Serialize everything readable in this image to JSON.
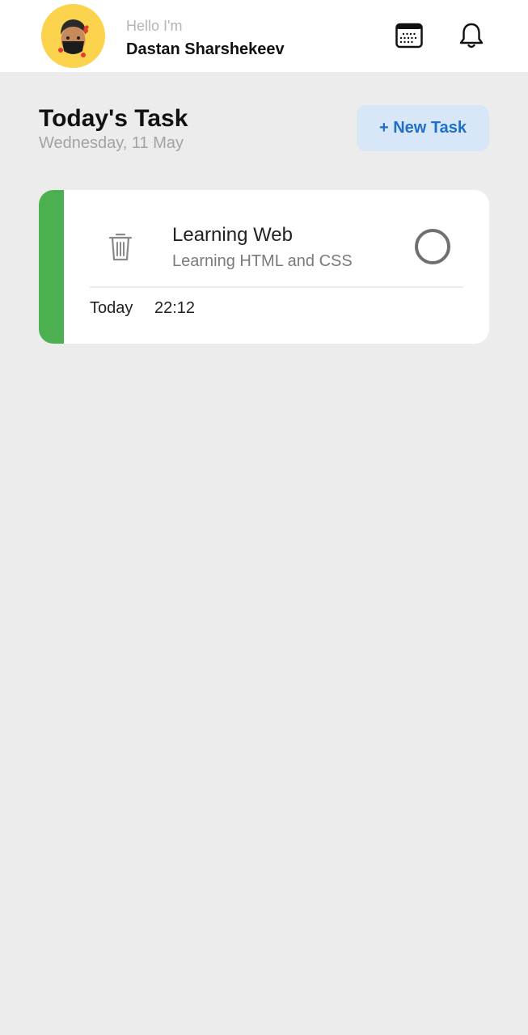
{
  "header": {
    "greeting": "Hello I'm",
    "username": "Dastan Sharshekeev",
    "avatar_bg": "#fcd34d",
    "icons": [
      "calendar-icon",
      "bell-icon"
    ]
  },
  "main": {
    "title": "Today's Task",
    "date": "Wednesday, 11 May",
    "new_task_label": "+ New Task",
    "accent_color": "#1e6fc7"
  },
  "tasks": [
    {
      "title": "Learning Web",
      "subtitle": "Learning HTML and CSS",
      "day": "Today",
      "time": "22:12",
      "status_color": "#4caf50",
      "completed": false
    }
  ]
}
